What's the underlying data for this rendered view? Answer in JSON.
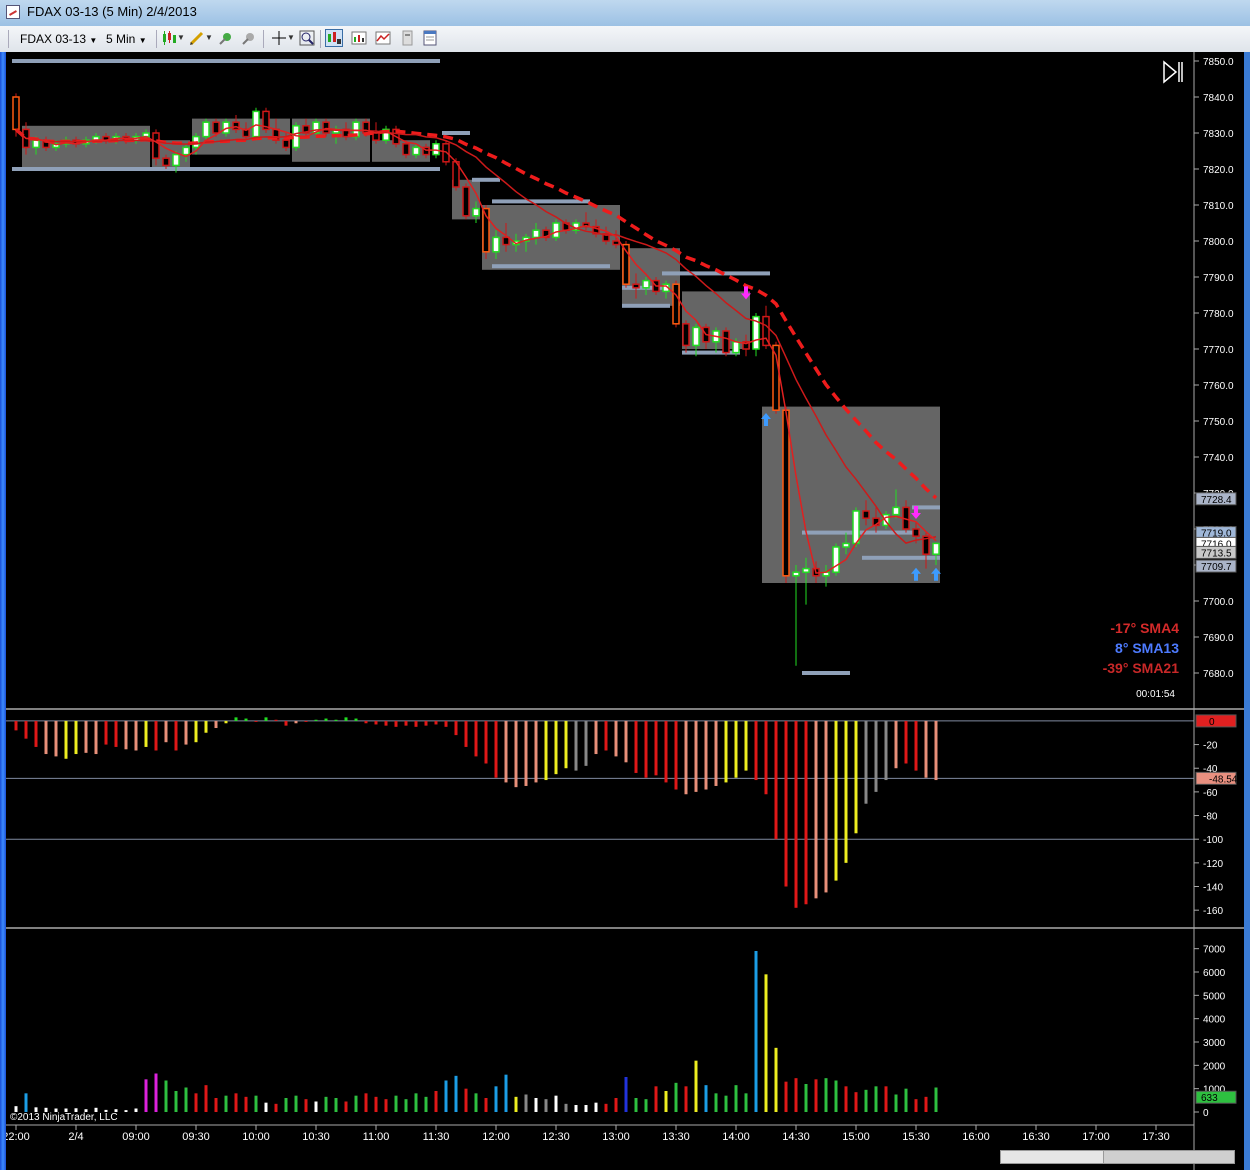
{
  "window": {
    "title": "FDAX 03-13 (5 Min)  2/4/2013"
  },
  "toolbar": {
    "instrument": "FDAX 03-13",
    "interval": "5 Min"
  },
  "price_panel": {
    "y_ticks": [
      "7850.0",
      "7840.0",
      "7830.0",
      "7820.0",
      "7810.0",
      "7800.0",
      "7790.0",
      "7780.0",
      "7770.0",
      "7760.0",
      "7750.0",
      "7740.0",
      "7730.0",
      "7720.0",
      "7710.0",
      "7700.0",
      "7690.0",
      "7680.0"
    ],
    "price_badges": [
      {
        "text": "7728.4",
        "y_value": 7728.4,
        "bg": "#aab4c8"
      },
      {
        "text": "7719.0",
        "y_value": 7719.0,
        "bg": "#9fb7d8"
      },
      {
        "text": "7716.0",
        "y_value": 7716.0,
        "bg": "#ffffff"
      },
      {
        "text": "7713.5",
        "y_value": 7713.5,
        "bg": "#c8c8c8"
      },
      {
        "text": "7709.7",
        "y_value": 7709.7,
        "bg": "#aab4c8"
      }
    ],
    "legend": [
      {
        "angle": "-17°",
        "name": "SMA4",
        "color": "#d42a2a"
      },
      {
        "angle": "8°",
        "name": "SMA13",
        "color": "#4d7bff"
      },
      {
        "angle": "-39°",
        "name": "SMA21",
        "color": "#c82828"
      }
    ],
    "timer": "00:01:54"
  },
  "oscillator_panel": {
    "y_ticks": [
      "-20",
      "-40",
      "-60",
      "-80",
      "-100",
      "-120",
      "-140",
      "-160"
    ],
    "badges": [
      {
        "text": "0",
        "value": 0,
        "bg": "#e02020"
      },
      {
        "text": "-48.54",
        "value": -48.54,
        "bg": "#e89080"
      }
    ]
  },
  "volume_panel": {
    "y_ticks": [
      "7000",
      "6000",
      "5000",
      "4000",
      "3000",
      "2000",
      "1000",
      "0"
    ],
    "badge": {
      "text": "633",
      "value": 633,
      "bg": "#2ec040"
    },
    "copyright": "©2013 NinjaTrader, LLC"
  },
  "time_axis": {
    "labels": [
      "22:00",
      "2/4",
      "09:00",
      "09:30",
      "10:00",
      "10:30",
      "11:00",
      "11:30",
      "12:00",
      "12:30",
      "13:00",
      "13:30",
      "14:00",
      "14:30",
      "15:00",
      "15:30",
      "16:00",
      "16:30",
      "17:00",
      "17:30"
    ]
  },
  "chart_data": {
    "type": "candlestick",
    "instrument": "FDAX 03-13",
    "interval": "5 Min",
    "price_range": [
      7676,
      7852
    ],
    "candles": [
      [
        7840,
        7841,
        7829,
        7831
      ],
      [
        7831,
        7833,
        7824,
        7826
      ],
      [
        7826,
        7829,
        7824,
        7828
      ],
      [
        7828,
        7829,
        7825,
        7826
      ],
      [
        7826,
        7828,
        7825,
        7827
      ],
      [
        7827,
        7829,
        7826,
        7828
      ],
      [
        7828,
        7829,
        7826,
        7827
      ],
      [
        7827,
        7829,
        7826,
        7828
      ],
      [
        7828,
        7830,
        7827,
        7829
      ],
      [
        7829,
        7830,
        7827,
        7828
      ],
      [
        7828,
        7830,
        7827,
        7829
      ],
      [
        7829,
        7830,
        7827,
        7828
      ],
      [
        7828,
        7830,
        7827,
        7829
      ],
      [
        7829,
        7831,
        7828,
        7830
      ],
      [
        7830,
        7831,
        7821,
        7823
      ],
      [
        7823,
        7824,
        7820,
        7821
      ],
      [
        7821,
        7825,
        7819,
        7824
      ],
      [
        7824,
        7827,
        7822,
        7826
      ],
      [
        7826,
        7830,
        7824,
        7829
      ],
      [
        7829,
        7834,
        7828,
        7833
      ],
      [
        7833,
        7834,
        7829,
        7830
      ],
      [
        7830,
        7834,
        7829,
        7833
      ],
      [
        7833,
        7835,
        7830,
        7831
      ],
      [
        7831,
        7833,
        7828,
        7829
      ],
      [
        7829,
        7837,
        7828,
        7836
      ],
      [
        7836,
        7837,
        7830,
        7831
      ],
      [
        7831,
        7834,
        7827,
        7828
      ],
      [
        7828,
        7830,
        7825,
        7826
      ],
      [
        7826,
        7833,
        7825,
        7832
      ],
      [
        7832,
        7834,
        7829,
        7830
      ],
      [
        7830,
        7834,
        7829,
        7833
      ],
      [
        7833,
        7834,
        7829,
        7830
      ],
      [
        7830,
        7832,
        7827,
        7831
      ],
      [
        7831,
        7833,
        7828,
        7829
      ],
      [
        7829,
        7834,
        7828,
        7833
      ],
      [
        7833,
        7834,
        7829,
        7830
      ],
      [
        7830,
        7833,
        7827,
        7828
      ],
      [
        7828,
        7832,
        7827,
        7831
      ],
      [
        7831,
        7832,
        7826,
        7827
      ],
      [
        7827,
        7828,
        7823,
        7824
      ],
      [
        7824,
        7827,
        7823,
        7826
      ],
      [
        7826,
        7827,
        7823,
        7824
      ],
      [
        7824,
        7828,
        7823,
        7827
      ],
      [
        7827,
        7828,
        7821,
        7822
      ],
      [
        7822,
        7823,
        7814,
        7815
      ],
      [
        7815,
        7816,
        7806,
        7807
      ],
      [
        7807,
        7811,
        7805,
        7809
      ],
      [
        7809,
        7810,
        7795,
        7797
      ],
      [
        7797,
        7803,
        7795,
        7801
      ],
      [
        7801,
        7805,
        7797,
        7799
      ],
      [
        7799,
        7802,
        7797,
        7800
      ],
      [
        7800,
        7802,
        7797,
        7801
      ],
      [
        7801,
        7805,
        7799,
        7803
      ],
      [
        7803,
        7804,
        7800,
        7801
      ],
      [
        7801,
        7806,
        7800,
        7805
      ],
      [
        7805,
        7806,
        7802,
        7803
      ],
      [
        7803,
        7806,
        7802,
        7805
      ],
      [
        7805,
        7808,
        7803,
        7804
      ],
      [
        7804,
        7806,
        7801,
        7802
      ],
      [
        7802,
        7804,
        7799,
        7800
      ],
      [
        7800,
        7803,
        7798,
        7799
      ],
      [
        7799,
        7800,
        7787,
        7788
      ],
      [
        7788,
        7791,
        7784,
        7787
      ],
      [
        7787,
        7790,
        7785,
        7789
      ],
      [
        7789,
        7790,
        7785,
        7786
      ],
      [
        7786,
        7789,
        7784,
        7788
      ],
      [
        7788,
        7789,
        7776,
        7777
      ],
      [
        7777,
        7778,
        7769,
        7771
      ],
      [
        7771,
        7777,
        7768,
        7776
      ],
      [
        7776,
        7777,
        7770,
        7772
      ],
      [
        7772,
        7776,
        7769,
        7775
      ],
      [
        7775,
        7776,
        7768,
        7769
      ],
      [
        7769,
        7773,
        7768,
        7772
      ],
      [
        7772,
        7774,
        7768,
        7770
      ],
      [
        7770,
        7780,
        7768,
        7779
      ],
      [
        7779,
        7782,
        7770,
        7771
      ],
      [
        7771,
        7772,
        7752,
        7753
      ],
      [
        7753,
        7754,
        7705,
        7707
      ],
      [
        7707,
        7710,
        7682,
        7708
      ],
      [
        7708,
        7712,
        7699,
        7709
      ],
      [
        7709,
        7711,
        7705,
        7707
      ],
      [
        7707,
        7710,
        7704,
        7708
      ],
      [
        7708,
        7716,
        7707,
        7715
      ],
      [
        7715,
        7719,
        7713,
        7716
      ],
      [
        7716,
        7726,
        7715,
        7725
      ],
      [
        7725,
        7728,
        7721,
        7723
      ],
      [
        7723,
        7726,
        7719,
        7721
      ],
      [
        7721,
        7725,
        7720,
        7724
      ],
      [
        7724,
        7731,
        7723,
        7726
      ],
      [
        7726,
        7728,
        7719,
        7720
      ],
      [
        7720,
        7722,
        7716,
        7718
      ],
      [
        7718,
        7719,
        7709,
        7713
      ],
      [
        7713,
        7716,
        7710,
        7716
      ]
    ],
    "oscillator_values": [
      -8,
      -15,
      -22,
      -28,
      -30,
      -32,
      -28,
      -27,
      -28,
      -20,
      -22,
      -24,
      -25,
      -22,
      -25,
      -18,
      -25,
      -20,
      -18,
      -10,
      -6,
      -2,
      3,
      2,
      0,
      3,
      1,
      -4,
      -2,
      0,
      1,
      2,
      1,
      3,
      2,
      -2,
      -3,
      -4,
      -5,
      -4,
      -5,
      -4,
      -3,
      -5,
      -12,
      -22,
      -30,
      -36,
      -48,
      -52,
      -56,
      -55,
      -52,
      -50,
      -45,
      -40,
      -42,
      -38,
      -28,
      -25,
      -30,
      -35,
      -44,
      -48,
      -46,
      -52,
      -58,
      -62,
      -60,
      -58,
      -55,
      -52,
      -48,
      -42,
      -50,
      -62,
      -100,
      -140,
      -158,
      -155,
      -150,
      -145,
      -135,
      -120,
      -95,
      -70,
      -60,
      -50,
      -40,
      -36,
      -42,
      -48,
      -50
    ],
    "oscillator_colors": [
      "#e01818",
      "#e01818",
      "#e01818",
      "#e8907a",
      "#e8907a",
      "#eeee20",
      "#eeee20",
      "#e8907a",
      "#e8907a",
      "#e01818",
      "#e01818",
      "#e8907a",
      "#e8907a",
      "#eeee20",
      "#e01818",
      "#e8907a",
      "#e01818",
      "#e8907a",
      "#eeee20",
      "#eeee20",
      "#e8907a",
      "#eeee20",
      "#22dd22",
      "#22dd22",
      "#e01818",
      "#22dd22",
      "#e01818",
      "#e01818",
      "#e8907a",
      "#e01818",
      "#22dd22",
      "#22dd22",
      "#22dd22",
      "#22dd22",
      "#22dd22",
      "#e01818",
      "#e01818",
      "#e01818",
      "#e01818",
      "#e01818",
      "#e01818",
      "#e01818",
      "#e01818",
      "#e01818",
      "#e01818",
      "#e01818",
      "#e01818",
      "#e01818",
      "#e01818",
      "#e8907a",
      "#e8907a",
      "#e8907a",
      "#e8907a",
      "#eeee20",
      "#eeee20",
      "#eeee20",
      "#888888",
      "#888888",
      "#e8907a",
      "#e01818",
      "#e8907a",
      "#e8907a",
      "#e01818",
      "#e01818",
      "#e01818",
      "#e01818",
      "#e01818",
      "#e8907a",
      "#e8907a",
      "#e8907a",
      "#e8907a",
      "#eeee20",
      "#eeee20",
      "#eeee20",
      "#e01818",
      "#e01818",
      "#e01818",
      "#e01818",
      "#e01818",
      "#e01818",
      "#e8907a",
      "#e8907a",
      "#eeee20",
      "#eeee20",
      "#eeee20",
      "#888888",
      "#888888",
      "#888888",
      "#e8907a",
      "#e01818",
      "#e01818",
      "#e8907a",
      "#e8907a"
    ],
    "volumes": [
      250,
      800,
      200,
      180,
      150,
      150,
      160,
      120,
      180,
      90,
      120,
      80,
      150,
      1400,
      1650,
      1350,
      900,
      1050,
      800,
      1150,
      600,
      700,
      800,
      650,
      700,
      400,
      350,
      600,
      700,
      550,
      450,
      650,
      600,
      450,
      700,
      800,
      650,
      550,
      700,
      550,
      800,
      650,
      900,
      1350,
      1550,
      1000,
      800,
      600,
      1100,
      1600,
      650,
      750,
      600,
      550,
      700,
      350,
      300,
      300,
      400,
      350,
      600,
      1500,
      600,
      550,
      1100,
      900,
      1250,
      1100,
      2200,
      1150,
      800,
      700,
      1150,
      800,
      6900,
      5900,
      2750,
      1300,
      1450,
      1200,
      1400,
      1450,
      1350,
      1100,
      850,
      950,
      1100,
      1100,
      750,
      1000,
      550,
      650,
      1050
    ],
    "volume_colors": [
      "#ffffff",
      "#1c9ee6",
      "#ffffff",
      "#ffffff",
      "#ffffff",
      "#ffffff",
      "#ffffff",
      "#ffffff",
      "#ffffff",
      "#ffffff",
      "#ffffff",
      "#ffffff",
      "#ffffff",
      "#dd22dd",
      "#dd22dd",
      "#2ec040",
      "#2ec040",
      "#2ec040",
      "#e01818",
      "#e01818",
      "#e01818",
      "#2ec040",
      "#e01818",
      "#e01818",
      "#2ec040",
      "#ffffff",
      "#e01818",
      "#2ec040",
      "#2ec040",
      "#e01818",
      "#ffffff",
      "#2ec040",
      "#2ec040",
      "#e01818",
      "#2ec040",
      "#e01818",
      "#e01818",
      "#e01818",
      "#2ec040",
      "#2ec040",
      "#2ec040",
      "#2ec040",
      "#e01818",
      "#1c9ee6",
      "#1c9ee6",
      "#e01818",
      "#2ec040",
      "#e01818",
      "#1c9ee6",
      "#1c9ee6",
      "#eeee20",
      "#888888",
      "#ffffff",
      "#888888",
      "#ffffff",
      "#888888",
      "#ffffff",
      "#ffffff",
      "#ffffff",
      "#e01818",
      "#e01818",
      "#2233dd",
      "#2ec040",
      "#2ec040",
      "#e01818",
      "#eeee20",
      "#2ec040",
      "#e01818",
      "#eeee20",
      "#1c9ee6",
      "#2ec040",
      "#2ec040",
      "#2ec040",
      "#2ec040",
      "#1c9ee6",
      "#eeee20",
      "#eeee20",
      "#e01818",
      "#e01818",
      "#2ec040",
      "#e01818",
      "#2ec040",
      "#2ec040",
      "#e01818",
      "#e01818",
      "#2ec040",
      "#2ec040",
      "#e01818",
      "#2ec040",
      "#2ec040",
      "#e01818",
      "#e01818",
      "#2ec040"
    ],
    "volume_range": [
      0,
      7500
    ],
    "oscillator_range": [
      -170,
      5
    ]
  }
}
